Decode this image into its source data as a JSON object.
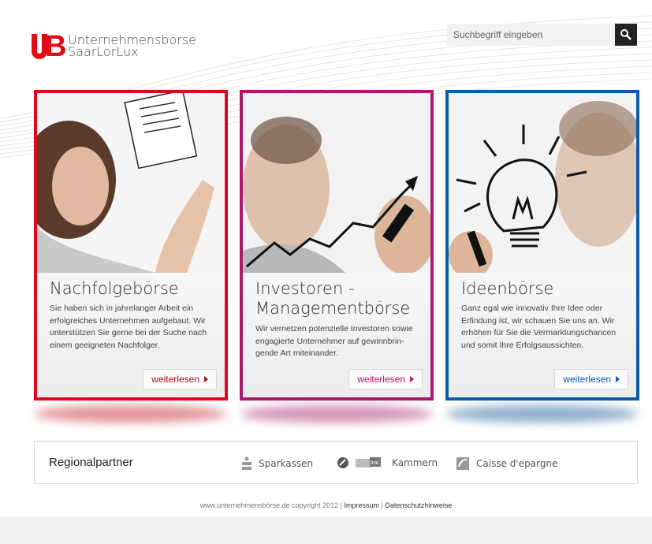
{
  "logo": {
    "line1": "Unternehmensbörse",
    "line2": "SaarLorLux",
    "brand_color": "#e30613"
  },
  "search": {
    "placeholder": "Suchbegriff eingeben",
    "button_icon": "search-icon"
  },
  "cards": [
    {
      "title": "Nachfolgebörse",
      "text": "Sie haben sich in jahrelanger Arbeit ein erfolgreiches Unternehmen aufgebaut. Wir unterstützen Sie gerne bei der Suche nach einem geeigneten Nachfolger.",
      "button": "weiterlesen",
      "color": "#e0061b"
    },
    {
      "title_line1": "Investoren -",
      "title_line2": "Managementbörse",
      "text": "Wir vernetzen potenzielle Investoren sowie engagierte Unternehmer auf gewinnbrin-gende Art miteinander.",
      "button": "weiterlesen",
      "color": "#b0166f"
    },
    {
      "title": "Ideenbörse",
      "text": "Ganz egal wie innovativ Ihre Idee oder Erfindung ist, wir schauen Sie uns an. Wir erhöhen für Sie die Vermarktungschancen und somit Ihre Erfolgsaussichten.",
      "button": "weiterlesen",
      "color": "#0a5ba8"
    }
  ],
  "partners": {
    "title": "Regionalpartner",
    "items": [
      {
        "label": "Sparkassen",
        "icon": "sparkasse-icon"
      },
      {
        "label": "IHK",
        "icon": "ihk-logo-icon"
      },
      {
        "label": "Kammern",
        "icon": "kammer-logo-icon"
      },
      {
        "label": "Caisse d'epargne",
        "icon": "caisse-epargne-icon"
      }
    ]
  },
  "footer": {
    "copyright": "www.unternehmensbörse.de copyright 2012 | ",
    "impressum": "Impressum",
    "separator": " | ",
    "datenschutz": "Datenschutzhinweise"
  }
}
